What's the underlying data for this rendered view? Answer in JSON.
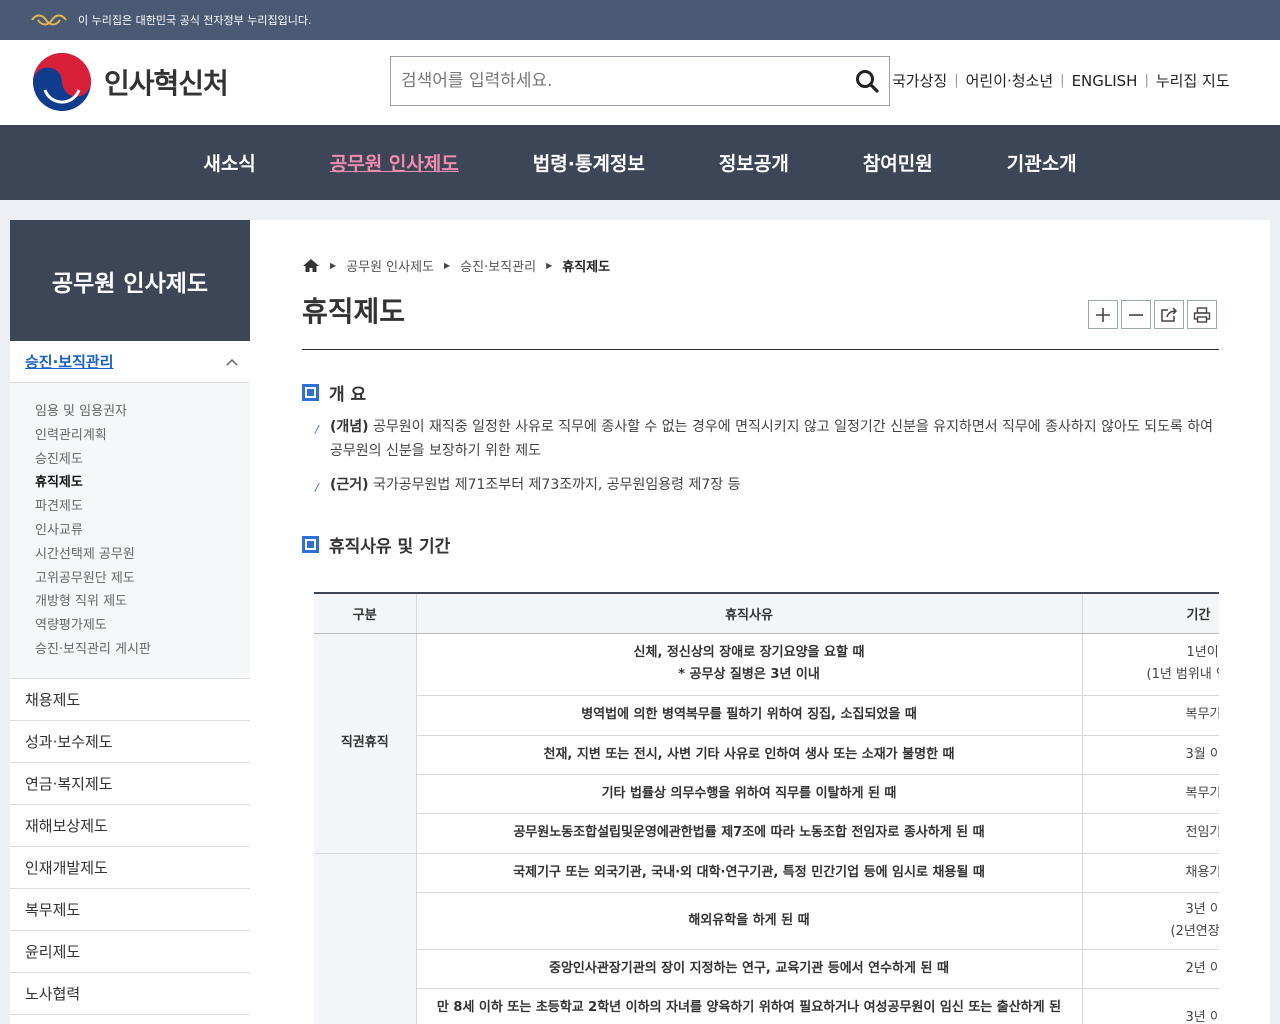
{
  "topbar": {
    "notice": "이 누리집은 대한민국 공식 전자정부 누리집입니다."
  },
  "header": {
    "logo_text": "인사혁신처",
    "search_placeholder": "검색어를 입력하세요.",
    "utility_links": [
      "국가상징",
      "어린이·청소년",
      "ENGLISH",
      "누리집 지도"
    ]
  },
  "gnb": {
    "items": [
      "새소식",
      "공무원 인사제도",
      "법령·통계정보",
      "정보공개",
      "참여민원",
      "기관소개"
    ]
  },
  "lnb": {
    "title": "공무원 인사제도",
    "current": "승진·보직관리",
    "sub_items": [
      "임용 및 임용권자",
      "인력관리계획",
      "승진제도",
      "휴직제도",
      "파견제도",
      "인사교류",
      "시간선택제 공무원",
      "고위공무원단 제도",
      "개방형 직위 제도",
      "역량평가제도",
      "승진·보직관리 게시판"
    ],
    "items": [
      "채용제도",
      "성과·보수제도",
      "연금·복지제도",
      "재해보상제도",
      "인재개발제도",
      "복무제도",
      "윤리제도",
      "노사협력"
    ]
  },
  "breadcrumb": {
    "items": [
      "공무원 인사제도",
      "승진·보직관리"
    ],
    "current": "휴직제도"
  },
  "page_title": "휴직제도",
  "sections": {
    "overview": {
      "heading": "개 요",
      "concept_label": "(개념)",
      "concept_text": " 공무원이 재직중 일정한 사유로 직무에 종사할 수 없는 경우에 면직시키지 않고 일정기간 신분을 유지하면서 직무에 종사하지 않아도 되도록 하여 공무원의 신분을 보장하기 위한 제도",
      "basis_label": "(근거)",
      "basis_text": " 국가공무원법 제71조부터 제73조까지, 공무원임용령 제7장 등"
    },
    "reasons": {
      "heading": "휴직사유 및 기간",
      "headers": [
        "구분",
        "휴직사유",
        "기간"
      ],
      "group1": "직권휴직",
      "rows": [
        {
          "reason": "신체, 정신상의 장애로 장기요양을 요할 때",
          "reason2": "* 공무상 질병은 3년 이내",
          "period": "1년이",
          "period2": "(1년 범위내 연"
        },
        {
          "reason": "병역법에 의한 병역복무를 필하기 위하여 징집, 소집되었을 때",
          "period": "복무기"
        },
        {
          "reason": "천재, 지변 또는 전시, 사변 기타 사유로 인하여 생사 또는 소재가 불명한 때",
          "period": "3월 이"
        },
        {
          "reason": "기타 법률상 의무수행을 위하여 직무를 이탈하게 된 때",
          "period": "복무기"
        },
        {
          "reason": "공무원노동조합설립및운영에관한법률 제7조에 따라 노동조합 전임자로 종사하게 된 때",
          "period": "전임기"
        },
        {
          "reason": "국제기구 또는 외국기관, 국내·외 대학·연구기관, 특정 민간기업 등에 임시로 채용될 때",
          "period": "채용기"
        },
        {
          "reason": "해외유학을 하게 된 때",
          "period": "3년 이",
          "period2": "(2년연장"
        },
        {
          "reason": "중앙인사관장기관의 장이 지정하는 연구, 교육기관 등에서 연수하게 된 때",
          "period": "2년 이"
        },
        {
          "reason": "만 8세 이하 또는 초등학교 2학년 이하의 자녀를 양육하기 위하여 필요하거나 여성공무원이 임신 또는 출산하게 된",
          "period": "3년 이"
        }
      ]
    }
  },
  "colors": {
    "topbar": "#4b5a74",
    "gnb": "#3c4656",
    "active_menu": "#f38cb0",
    "accent_blue": "#2f6fd6",
    "lnb_current": "#1760c7"
  }
}
